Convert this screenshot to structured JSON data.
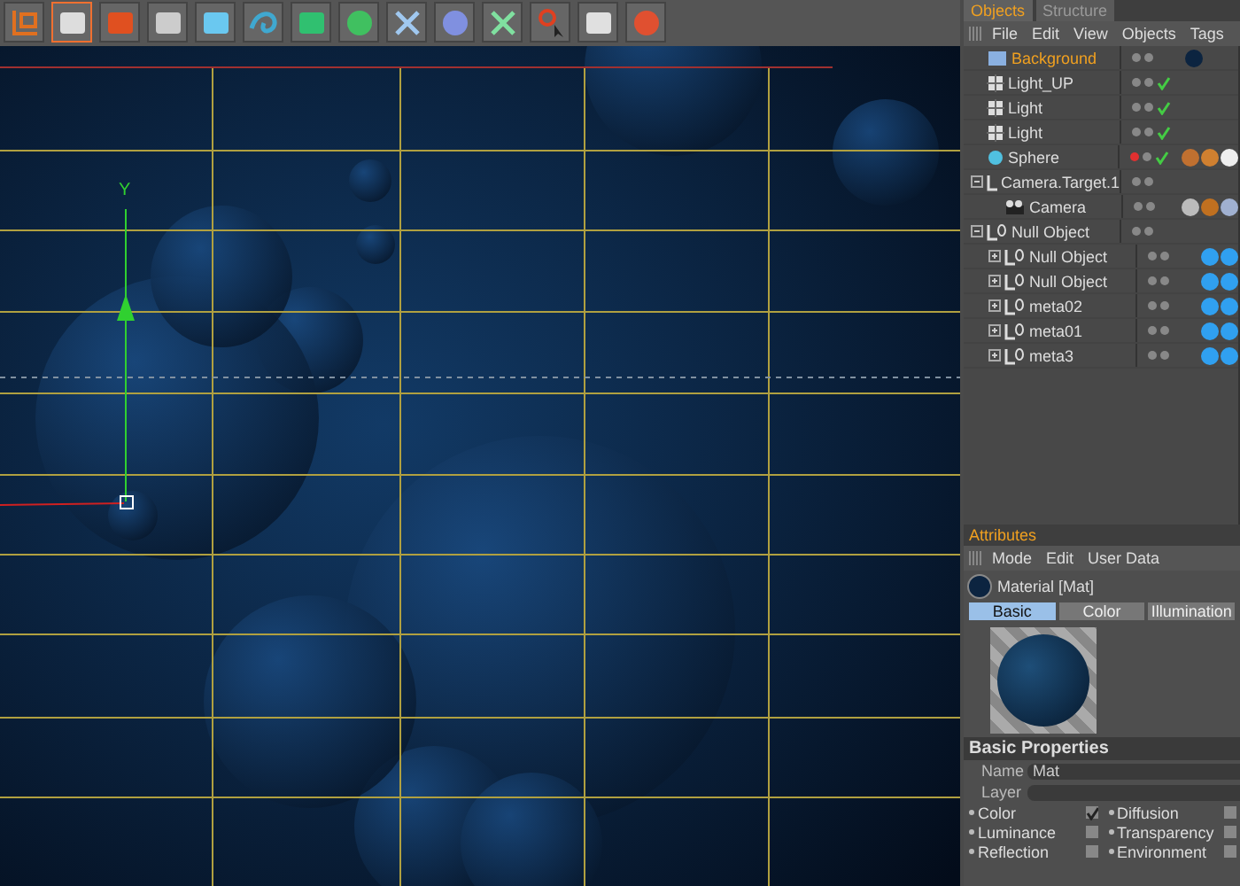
{
  "toolbar": {
    "tools": [
      {
        "kind": "axis",
        "selected": false
      },
      {
        "kind": "render-view",
        "selected": true
      },
      {
        "kind": "render-region",
        "selected": false
      },
      {
        "kind": "render-settings",
        "selected": false
      },
      {
        "kind": "cube",
        "selected": false
      },
      {
        "kind": "spline",
        "selected": false
      },
      {
        "kind": "nurbs",
        "selected": false
      },
      {
        "kind": "array",
        "selected": false
      },
      {
        "kind": "deformer",
        "selected": false
      },
      {
        "kind": "scene",
        "selected": false
      },
      {
        "kind": "particles",
        "selected": false
      },
      {
        "kind": "help",
        "selected": false
      },
      {
        "kind": "table",
        "selected": false
      },
      {
        "kind": "globe",
        "selected": false
      }
    ]
  },
  "viewport": {
    "axis_label": "Y"
  },
  "objects": {
    "tabs": [
      {
        "label": "Objects",
        "selected": true
      },
      {
        "label": "Structure",
        "selected": false
      }
    ],
    "menu": [
      "File",
      "Edit",
      "View",
      "Objects",
      "Tags"
    ],
    "tree": [
      {
        "name": "Background",
        "kind": "background",
        "selected": true,
        "check": false,
        "hidden": false,
        "tags": [
          {
            "kind": "dark-material"
          }
        ]
      },
      {
        "name": "Light_UP",
        "kind": "light",
        "selected": false,
        "check": true,
        "hidden": false
      },
      {
        "name": "Light",
        "kind": "light",
        "selected": false,
        "check": true,
        "hidden": false
      },
      {
        "name": "Light",
        "kind": "light",
        "selected": false,
        "check": true,
        "hidden": false
      },
      {
        "name": "Sphere",
        "kind": "sphere",
        "selected": false,
        "check": true,
        "hidden": true,
        "tags": [
          {
            "kind": "texture"
          },
          {
            "kind": "dots"
          },
          {
            "kind": "shading"
          }
        ]
      },
      {
        "name": "Camera.Target.1",
        "kind": "null",
        "selected": false,
        "check": false,
        "hidden": false,
        "expanded": true,
        "children": [
          {
            "name": "Camera",
            "kind": "camera",
            "selected": false,
            "check": false,
            "hidden": false,
            "tags": [
              {
                "kind": "target"
              },
              {
                "kind": "protection"
              },
              {
                "kind": "compositing"
              }
            ]
          }
        ]
      },
      {
        "name": "Null Object",
        "kind": "null",
        "selected": false,
        "check": false,
        "hidden": false,
        "expanded": true,
        "children": [
          {
            "name": "Null Object",
            "kind": "null",
            "selected": false,
            "check": false,
            "hidden": false,
            "expanded": false,
            "tags": [
              {
                "kind": "meta-material"
              },
              {
                "kind": "meta-material"
              }
            ]
          },
          {
            "name": "Null Object",
            "kind": "null",
            "selected": false,
            "check": false,
            "hidden": false,
            "expanded": false,
            "tags": [
              {
                "kind": "meta-material"
              },
              {
                "kind": "meta-material"
              }
            ]
          },
          {
            "name": "meta02",
            "kind": "null",
            "selected": false,
            "check": false,
            "hidden": false,
            "expanded": false,
            "tags": [
              {
                "kind": "meta-material"
              },
              {
                "kind": "meta-material"
              }
            ]
          },
          {
            "name": "meta01",
            "kind": "null",
            "selected": false,
            "check": false,
            "hidden": false,
            "expanded": false,
            "tags": [
              {
                "kind": "meta-material"
              },
              {
                "kind": "meta-material"
              }
            ]
          },
          {
            "name": "meta3",
            "kind": "null",
            "selected": false,
            "check": false,
            "hidden": false,
            "expanded": false,
            "tags": [
              {
                "kind": "meta-material"
              },
              {
                "kind": "meta-material"
              }
            ]
          }
        ]
      }
    ]
  },
  "attributes": {
    "title": "Attributes",
    "menu": [
      "Mode",
      "Edit",
      "User Data"
    ],
    "header": "Material [Mat]",
    "tabs": [
      {
        "label": "Basic",
        "selected": true
      },
      {
        "label": "Color",
        "selected": false
      },
      {
        "label": "Illumination",
        "selected": false
      }
    ],
    "section": "Basic Properties",
    "fields": [
      {
        "label": "Name",
        "value": "Mat"
      },
      {
        "label": "Layer"
      }
    ],
    "channels": [
      {
        "label": "Color",
        "checked": true
      },
      {
        "label": "Diffusion",
        "checked": false
      },
      {
        "label": "Luminance",
        "checked": false
      },
      {
        "label": "Transparency",
        "checked": false
      },
      {
        "label": "Reflection",
        "checked": false
      },
      {
        "label": "Environment",
        "checked": false
      }
    ]
  }
}
